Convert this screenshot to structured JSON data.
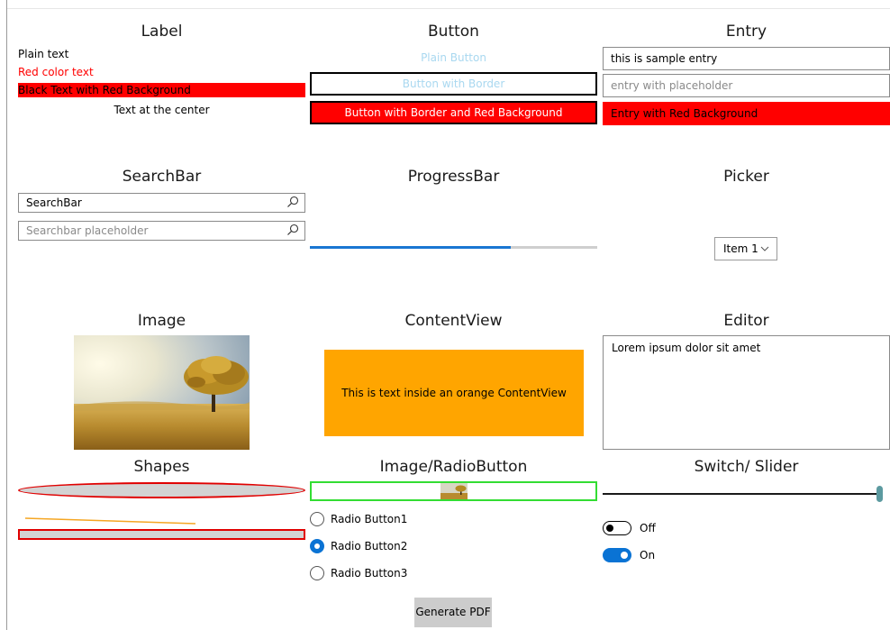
{
  "sections": {
    "label": "Label",
    "button": "Button",
    "entry": "Entry",
    "searchbar": "SearchBar",
    "progressbar": "ProgressBar",
    "picker": "Picker",
    "image": "Image",
    "contentview": "ContentView",
    "editor": "Editor",
    "shapes": "Shapes",
    "image_radio": "Image/RadioButton",
    "switch_slider": "Switch/ Slider"
  },
  "labels": {
    "plain": "Plain text",
    "red": "Red color text",
    "red_bg": "Black Text with Red Background",
    "center": "Text at the center"
  },
  "buttons": {
    "plain": "Plain Button",
    "bordered": "Button with Border",
    "bordered_red": "Button with Border and Red Background"
  },
  "entries": {
    "sample_value": "this is sample entry",
    "placeholder": "entry with placeholder",
    "red_value": "Entry with Red Background"
  },
  "searchbars": {
    "value": "SearchBar",
    "placeholder": "Searchbar placeholder",
    "icon": "search-icon"
  },
  "progress": {
    "value": 0.7,
    "color": "#1976d2"
  },
  "picker": {
    "selected": "Item 1",
    "icon": "chevron-down-icon"
  },
  "contentview": {
    "text": "This is text inside an orange ContentView",
    "color": "#ffa500"
  },
  "editor": {
    "text": "Lorem ipsum dolor sit amet"
  },
  "radios": [
    {
      "label": "Radio Button1",
      "checked": false
    },
    {
      "label": "Radio Button2",
      "checked": true
    },
    {
      "label": "Radio Button3",
      "checked": false
    }
  ],
  "slider": {
    "value": 1.0
  },
  "switches": [
    {
      "label": "Off",
      "on": false
    },
    {
      "label": "On",
      "on": true
    }
  ],
  "actions": {
    "generate_pdf": "Generate PDF"
  },
  "colors": {
    "accent": "#0a73d4",
    "red": "#ff0000",
    "green_border": "#33dd33",
    "slider_thumb": "#5c9aa0"
  }
}
